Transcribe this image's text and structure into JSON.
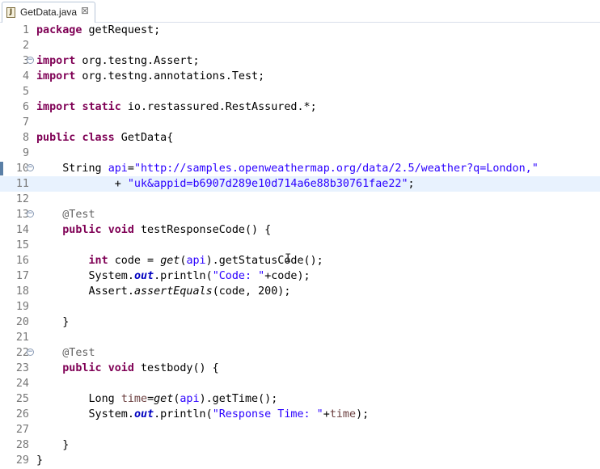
{
  "tab": {
    "title": "GetData.java",
    "icon": "java-file-icon",
    "close_glyph": "⊠"
  },
  "lines": [
    {
      "n": "1",
      "tokens": [
        {
          "t": "k",
          "v": "package"
        },
        {
          "t": "p",
          "v": " getRequest;"
        }
      ]
    },
    {
      "n": "2",
      "tokens": []
    },
    {
      "n": "3",
      "fold": true,
      "tokens": [
        {
          "t": "k",
          "v": "import"
        },
        {
          "t": "p",
          "v": " org.testng.Assert;"
        }
      ]
    },
    {
      "n": "4",
      "tokens": [
        {
          "t": "k",
          "v": "import"
        },
        {
          "t": "p",
          "v": " org.testng.annotations.Test;"
        }
      ]
    },
    {
      "n": "5",
      "tokens": []
    },
    {
      "n": "6",
      "tokens": [
        {
          "t": "k",
          "v": "import"
        },
        {
          "t": "p",
          "v": " "
        },
        {
          "t": "k",
          "v": "static"
        },
        {
          "t": "p",
          "v": " io.restassured.RestAssured.*;"
        }
      ]
    },
    {
      "n": "7",
      "tokens": []
    },
    {
      "n": "8",
      "tokens": [
        {
          "t": "k",
          "v": "public"
        },
        {
          "t": "p",
          "v": " "
        },
        {
          "t": "k",
          "v": "class"
        },
        {
          "t": "p",
          "v": " GetData{"
        }
      ]
    },
    {
      "n": "9",
      "tokens": []
    },
    {
      "n": "10",
      "fold": true,
      "mark": true,
      "tokens": [
        {
          "t": "p",
          "v": "    String "
        },
        {
          "t": "f2",
          "v": "api"
        },
        {
          "t": "p",
          "v": "="
        },
        {
          "t": "s",
          "v": "\"http://samples.openweathermap.org/data/2.5/weather?q=London,\""
        }
      ]
    },
    {
      "n": "11",
      "mark": true,
      "hl": true,
      "tokens": [
        {
          "t": "p",
          "v": "            + "
        },
        {
          "t": "s",
          "v": "\"uk&appid=b6907d289e10d714a6e88b30761fae22\""
        },
        {
          "t": "p",
          "v": ";"
        }
      ]
    },
    {
      "n": "12",
      "tokens": []
    },
    {
      "n": "13",
      "fold": true,
      "tokens": [
        {
          "t": "p",
          "v": "    "
        },
        {
          "t": "a",
          "v": "@Test"
        }
      ]
    },
    {
      "n": "14",
      "tokens": [
        {
          "t": "p",
          "v": "    "
        },
        {
          "t": "k",
          "v": "public"
        },
        {
          "t": "p",
          "v": " "
        },
        {
          "t": "k",
          "v": "void"
        },
        {
          "t": "p",
          "v": " testResponseCode() {"
        }
      ]
    },
    {
      "n": "15",
      "tokens": []
    },
    {
      "n": "16",
      "tokens": [
        {
          "t": "p",
          "v": "        "
        },
        {
          "t": "k",
          "v": "int"
        },
        {
          "t": "p",
          "v": " code = "
        },
        {
          "t": "i",
          "v": "get"
        },
        {
          "t": "p",
          "v": "("
        },
        {
          "t": "f2",
          "v": "api"
        },
        {
          "t": "p",
          "v": ").getStatusCode();"
        }
      ]
    },
    {
      "n": "17",
      "tokens": [
        {
          "t": "p",
          "v": "        System."
        },
        {
          "t": "f",
          "v": "out"
        },
        {
          "t": "p",
          "v": ".println("
        },
        {
          "t": "s",
          "v": "\"Code: \""
        },
        {
          "t": "p",
          "v": "+code);"
        }
      ]
    },
    {
      "n": "18",
      "tokens": [
        {
          "t": "p",
          "v": "        Assert."
        },
        {
          "t": "i",
          "v": "assertEquals"
        },
        {
          "t": "p",
          "v": "(code, 200);"
        }
      ]
    },
    {
      "n": "19",
      "tokens": []
    },
    {
      "n": "20",
      "tokens": [
        {
          "t": "p",
          "v": "    }"
        }
      ]
    },
    {
      "n": "21",
      "tokens": []
    },
    {
      "n": "22",
      "fold": true,
      "tokens": [
        {
          "t": "p",
          "v": "    "
        },
        {
          "t": "a",
          "v": "@Test"
        }
      ]
    },
    {
      "n": "23",
      "tokens": [
        {
          "t": "p",
          "v": "    "
        },
        {
          "t": "k",
          "v": "public"
        },
        {
          "t": "p",
          "v": " "
        },
        {
          "t": "k",
          "v": "void"
        },
        {
          "t": "p",
          "v": " testbody() {"
        }
      ]
    },
    {
      "n": "24",
      "tokens": []
    },
    {
      "n": "25",
      "tokens": [
        {
          "t": "p",
          "v": "        Long "
        },
        {
          "t": "v",
          "v": "time"
        },
        {
          "t": "p",
          "v": "="
        },
        {
          "t": "i",
          "v": "get"
        },
        {
          "t": "p",
          "v": "("
        },
        {
          "t": "f2",
          "v": "api"
        },
        {
          "t": "p",
          "v": ").getTime();"
        }
      ]
    },
    {
      "n": "26",
      "tokens": [
        {
          "t": "p",
          "v": "        System."
        },
        {
          "t": "f",
          "v": "out"
        },
        {
          "t": "p",
          "v": ".println("
        },
        {
          "t": "s",
          "v": "\"Response Time: \""
        },
        {
          "t": "p",
          "v": "+"
        },
        {
          "t": "v",
          "v": "time"
        },
        {
          "t": "p",
          "v": ");"
        }
      ]
    },
    {
      "n": "27",
      "tokens": []
    },
    {
      "n": "28",
      "tokens": [
        {
          "t": "p",
          "v": "    }"
        }
      ]
    },
    {
      "n": "29",
      "tokens": [
        {
          "t": "p",
          "v": "}"
        }
      ]
    }
  ],
  "colors": {
    "keyword": "#7f0055",
    "string": "#2a00ff",
    "annotation": "#646464",
    "field": "#0000c0",
    "highlight": "#e8f2fe"
  }
}
